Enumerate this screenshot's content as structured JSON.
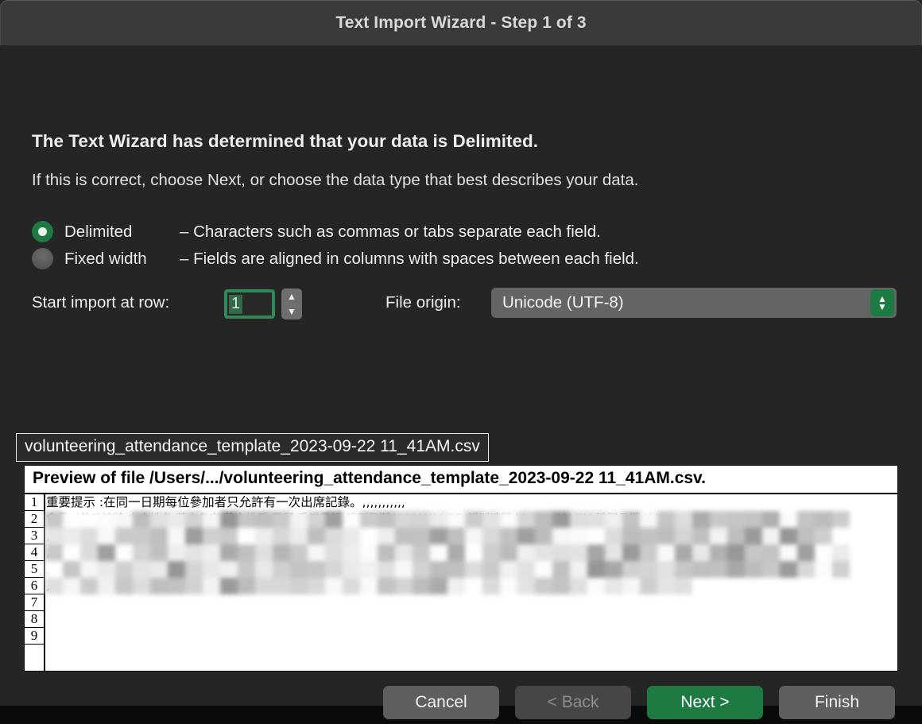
{
  "window": {
    "title": "Text Import Wizard - Step 1 of 3"
  },
  "main": {
    "heading": "The Text Wizard has determined that your data is Delimited.",
    "subheading": "If this is correct, choose Next, or choose the data type that best describes your data.",
    "options": [
      {
        "label": "Delimited",
        "description": "– Characters such as commas or tabs separate each field.",
        "selected": true
      },
      {
        "label": "Fixed width",
        "description": "– Fields are aligned in columns with spaces between each field.",
        "selected": false
      }
    ],
    "start_row": {
      "label": "Start import at row:",
      "value": "1",
      "stepper_up_icon": "chevron-up-icon",
      "stepper_down_icon": "chevron-down-icon"
    },
    "file_origin": {
      "label": "File origin:",
      "value": "Unicode (UTF-8)",
      "chevron_icon": "chevron-up-down-icon"
    }
  },
  "tooltip": {
    "filename": "volunteering_attendance_template_2023-09-22 11_41AM.csv"
  },
  "preview": {
    "title": "Preview of file /Users/.../volunteering_attendance_template_2023-09-22 11_41AM.csv.",
    "row_numbers": [
      "1",
      "2",
      "3",
      "4",
      "5",
      "6",
      "7",
      "8",
      "9"
    ],
    "rows": [
      "重要提示 :在同一日期每位參加者只允許有一次出席記錄。,,,,,,,,,,,",
      "會員／義工編號,中文姓名,英文名字,英文姓氏,電郵,手提電話,報到日期  YYYY-MM-DD,報到時間  hh:mmAM/PM,離開日期  YY",
      ",",
      ",",
      ",",
      ",",
      "",
      "",
      ""
    ]
  },
  "footer": {
    "buttons": [
      {
        "label": "Cancel",
        "style": "grey"
      },
      {
        "label": "< Back",
        "style": "disabled"
      },
      {
        "label": "Next >",
        "style": "green"
      },
      {
        "label": "Finish",
        "style": "grey"
      }
    ]
  },
  "colors": {
    "accent_green": "#1d7a43",
    "window_bg": "#252525",
    "titlebar_bg": "#3a3a3a"
  }
}
